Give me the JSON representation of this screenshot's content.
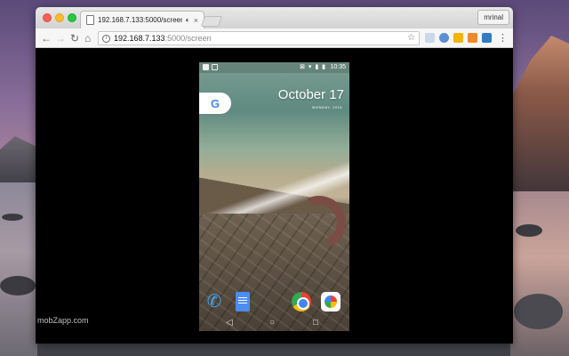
{
  "browser": {
    "tab_title": "192.168.7.133:5000/screen",
    "tab_close": "×",
    "profile_name": "mrinal",
    "url_host": "192.168.7.133",
    "url_path": ":5000/screen",
    "icons": {
      "back": "back-arrow-icon",
      "forward": "forward-arrow-icon",
      "reload": "reload-icon",
      "home": "home-icon",
      "bookmark": "star-icon",
      "menu": "vertical-dots-menu-icon"
    },
    "extensions": [
      {
        "name": "extension-cloud-icon",
        "color": "#8ab4d8"
      },
      {
        "name": "extension-person-icon",
        "color": "#5b8fd1"
      },
      {
        "name": "extension-orange-icon",
        "color": "#f4b400"
      },
      {
        "name": "extension-check-icon",
        "color": "#f08a24"
      },
      {
        "name": "extension-blue-icon",
        "color": "#2f7cc8"
      }
    ]
  },
  "phone": {
    "status_time": "10:35",
    "status_icons": "⊠ ▾ ▮ ▮",
    "date_main": "October 17",
    "date_sub": "MONDAY, 2016",
    "google_letter": "G",
    "dock": [
      "phone-app-icon",
      "docs-app-icon",
      "chrome-app-icon",
      "photos-app-icon"
    ],
    "nav_keys": {
      "back": "◁",
      "home": "○",
      "recents": "□"
    }
  },
  "watermark": "mobZapp.com"
}
